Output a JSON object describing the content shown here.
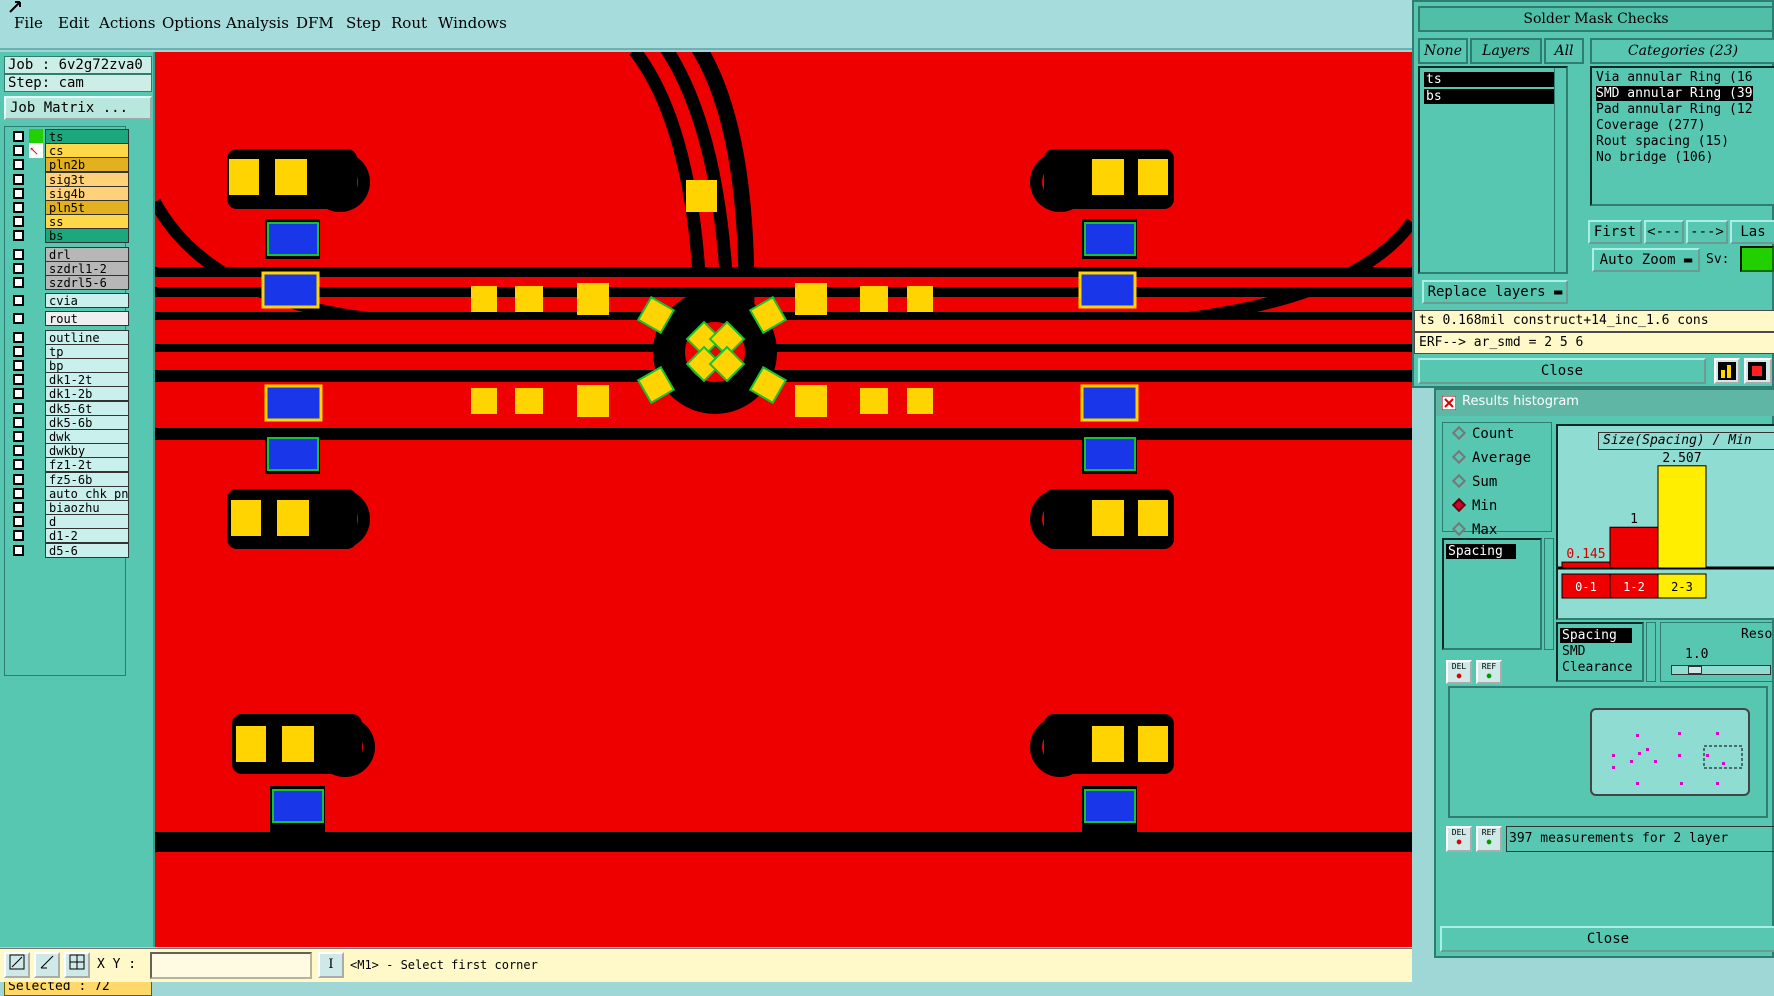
{
  "menu": {
    "items": [
      "File",
      "Edit",
      "Actions",
      "Options",
      "Analysis",
      "DFM",
      "Step",
      "Rout",
      "Windows"
    ]
  },
  "left": {
    "job_label": "Job : 6v2g72zva0",
    "step_label": "Step: cam",
    "job_matrix_label": "Job Matrix ...",
    "layers": [
      {
        "name": "ts",
        "color": "#1ca87c"
      },
      {
        "name": "cs",
        "color": "#ffd84a"
      },
      {
        "name": "pln2b",
        "color": "#e3b020"
      },
      {
        "name": "sig3t",
        "color": "#ffd27a"
      },
      {
        "name": "sig4b",
        "color": "#ffd27a"
      },
      {
        "name": "pln5t",
        "color": "#e3b020"
      },
      {
        "name": "ss",
        "color": "#ffd84a"
      },
      {
        "name": "bs",
        "color": "#1ca87c"
      },
      {
        "name": "drl",
        "color": "#b7b7b7"
      },
      {
        "name": "szdrl1-2",
        "color": "#b7b7b7"
      },
      {
        "name": "szdrl5-6",
        "color": "#b7b7b7"
      },
      {
        "name": "cvia",
        "color": "#c9f0ec"
      },
      {
        "name": "rout",
        "color": "#efefef"
      },
      {
        "name": "outline",
        "color": "#c9f0ec"
      },
      {
        "name": "tp",
        "color": "#c9f0ec"
      },
      {
        "name": "bp",
        "color": "#c9f0ec"
      },
      {
        "name": "dk1-2t",
        "color": "#c9f0ec"
      },
      {
        "name": "dk1-2b",
        "color": "#c9f0ec"
      },
      {
        "name": "dk5-6t",
        "color": "#c9f0ec"
      },
      {
        "name": "dk5-6b",
        "color": "#c9f0ec"
      },
      {
        "name": "dwk",
        "color": "#c9f0ec"
      },
      {
        "name": "dwkby",
        "color": "#c9f0ec"
      },
      {
        "name": "fz1-2t",
        "color": "#c9f0ec"
      },
      {
        "name": "fz5-6b",
        "color": "#c9f0ec"
      },
      {
        "name": "auto_chk_pn",
        "color": "#c9f0ec"
      },
      {
        "name": "biaozhu",
        "color": "#c9f0ec"
      },
      {
        "name": "d",
        "color": "#c9f0ec"
      },
      {
        "name": "d1-2",
        "color": "#c9f0ec"
      },
      {
        "name": "d5-6",
        "color": "#c9f0ec"
      }
    ],
    "selected_label": "Selected : 72"
  },
  "bottom": {
    "xy_label": "X Y :",
    "xy_value": "",
    "prompt": "<M1> - Select first corner"
  },
  "solder_mask": {
    "title": "Solder Mask Checks",
    "tab_none": "None",
    "tab_layers": "Layers",
    "tab_all": "All",
    "categories_label": "Categories (23)",
    "layers": [
      "ts",
      "bs"
    ],
    "categories": [
      "Via annular Ring (16",
      "SMD annular Ring (39",
      "Pad annular Ring (12",
      "Coverage (277)",
      "Rout spacing (15)",
      "No bridge (106)"
    ],
    "selected_category_index": 1,
    "nav_first": "First",
    "nav_prev": "<---",
    "nav_next": "--->",
    "nav_last": "Las",
    "auto_zoom_label": "Auto Zoom",
    "sv_label": "Sv:",
    "replace_layers_label": "Replace layers",
    "result_line": "ts 0.168mil  construct+14_inc_1.6  cons",
    "erf_line": "ERF--> ar_smd = 2 5 6",
    "close_label": "Close"
  },
  "histogram": {
    "title": "Results histogram",
    "radios": [
      {
        "label": "Count",
        "selected": false
      },
      {
        "label": "Average",
        "selected": false
      },
      {
        "label": "Sum",
        "selected": false
      },
      {
        "label": "Min",
        "selected": true
      },
      {
        "label": "Max",
        "selected": false
      }
    ],
    "measure_list": [
      "Spacing"
    ],
    "chart_title": "Size(Spacing) / Min",
    "subtype_list": [
      "Spacing",
      "SMD",
      "Clearance"
    ],
    "resolution_label": "Reso",
    "resolution_value": "1.0",
    "del_label": "DEL",
    "ref_label": "REF",
    "measurements_label": "397 measurements for 2 layer",
    "close_label": "Close"
  },
  "chart_data": {
    "type": "bar",
    "title": "Size(Spacing) / Min",
    "categories": [
      "0-1",
      "1-2",
      "2-3"
    ],
    "values": [
      0.145,
      1,
      2.507
    ],
    "data_labels": [
      "0.145",
      "1",
      "2.507"
    ],
    "colors": [
      "#ee0000",
      "#ee0000",
      "#ffee00"
    ],
    "ylim": [
      0,
      2.6
    ]
  }
}
